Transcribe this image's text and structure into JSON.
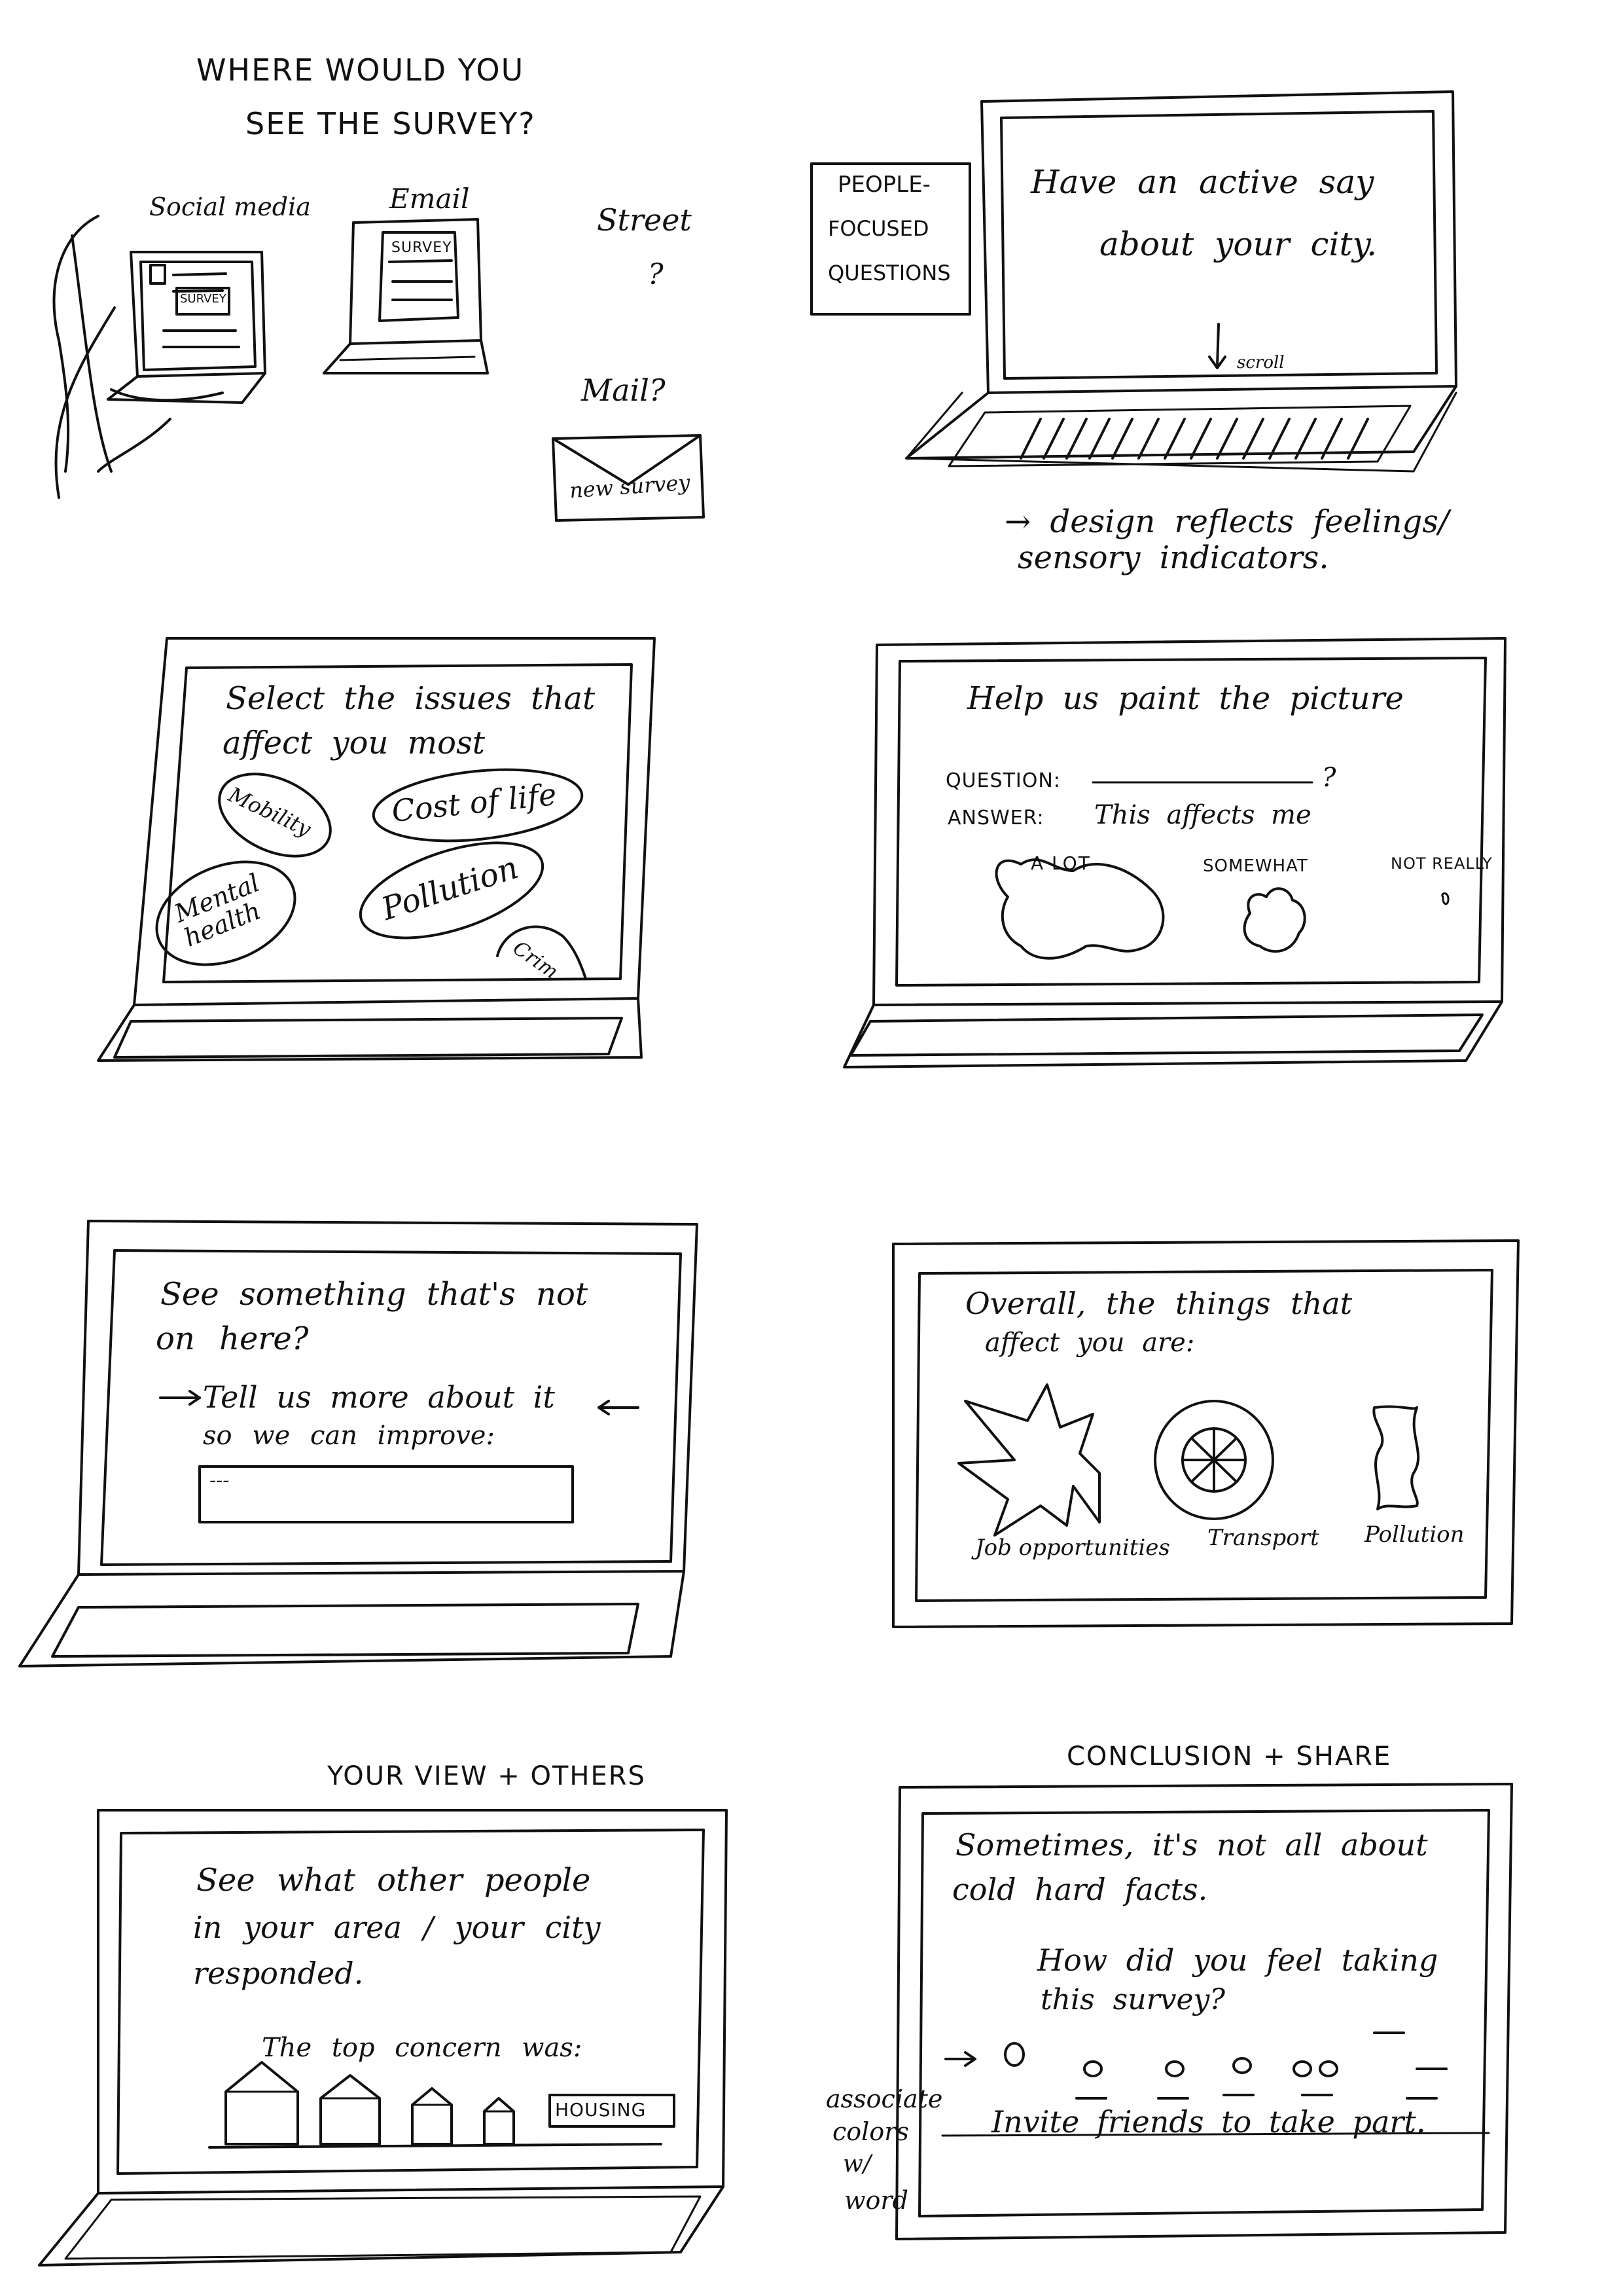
{
  "panel1": {
    "title_line1": "WHERE WOULD YOU",
    "title_line2": "SEE THE SURVEY?",
    "social_media": "Social media",
    "social_survey_tag": "SURVEY",
    "email": "Email",
    "email_survey_tag": "SURVEY",
    "street": "Street",
    "street_q": "?",
    "mail": "Mail?",
    "envelope_label": "new survey"
  },
  "panel2": {
    "side_box_line1": "PEOPLE-",
    "side_box_line2": "FOCUSED",
    "side_box_line3": "QUESTIONS",
    "screen_line1": "Have an active say",
    "screen_line2": "about your city.",
    "scroll": "scroll",
    "note_line1": "→ design reflects feelings/",
    "note_line2": "sensory indicators."
  },
  "panel3": {
    "line1": "Select the issues that",
    "line2": "affect you most",
    "bubbles": [
      "Mobility",
      "Cost of life",
      "Mental health",
      "Pollution",
      "Crim"
    ]
  },
  "panel4": {
    "title": "Help us paint the picture",
    "question_label": "QUESTION:",
    "question_end": "?",
    "answer_label": "ANSWER:",
    "answer_text": "This affects me",
    "options": [
      "A LOT",
      "SOMEWHAT",
      "NOT REALLY"
    ]
  },
  "panel5": {
    "line1": "See something that's not",
    "line2": "on here?",
    "line3": "Tell us more about it",
    "line4": "so we can improve:",
    "input_value": "---"
  },
  "panel6": {
    "line1": "Overall, the things that",
    "line2": "affect you are:",
    "items": [
      "Job opportunities",
      "Transport",
      "Pollution"
    ]
  },
  "panel7": {
    "header": "YOUR VIEW + OTHERS",
    "line1": "See what other people",
    "line2": "in your area / your city",
    "line3": "responded.",
    "line4": "The top concern was:",
    "tag": "HOUSING"
  },
  "panel8": {
    "header": "CONCLUSION + SHARE",
    "line1": "Sometimes, it's not all about",
    "line2": "cold hard facts.",
    "line3": "How did you feel taking",
    "line4": "this survey?",
    "invite": "Invite friends to take part.",
    "side_note_line1": "associate",
    "side_note_line2": "colors",
    "side_note_line3": "w/",
    "side_note_line4": "word"
  }
}
